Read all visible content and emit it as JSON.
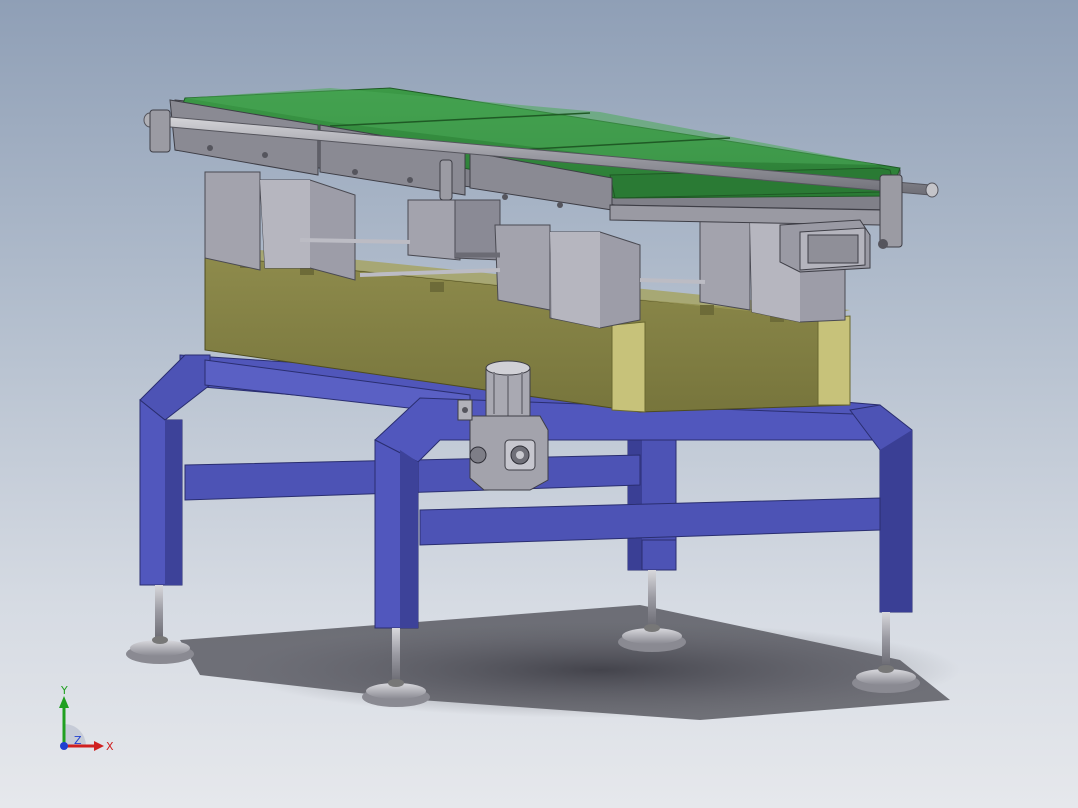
{
  "viewport": {
    "title": ""
  },
  "triad": {
    "x_label": "X",
    "y_label": "Y",
    "z_label": "Z"
  },
  "colors": {
    "frame": "#4f55b8",
    "frame_dark": "#353a8a",
    "frame_light": "#6d72cc",
    "belt": "#2f8a3a",
    "belt_light": "#48a854",
    "olive": "#878546",
    "olive_light": "#c9c479",
    "bracket": "#9a9aa6",
    "metal": "#c8c8cc",
    "axis_x": "#d02020",
    "axis_y": "#20a020",
    "axis_z": "#2040d0"
  }
}
